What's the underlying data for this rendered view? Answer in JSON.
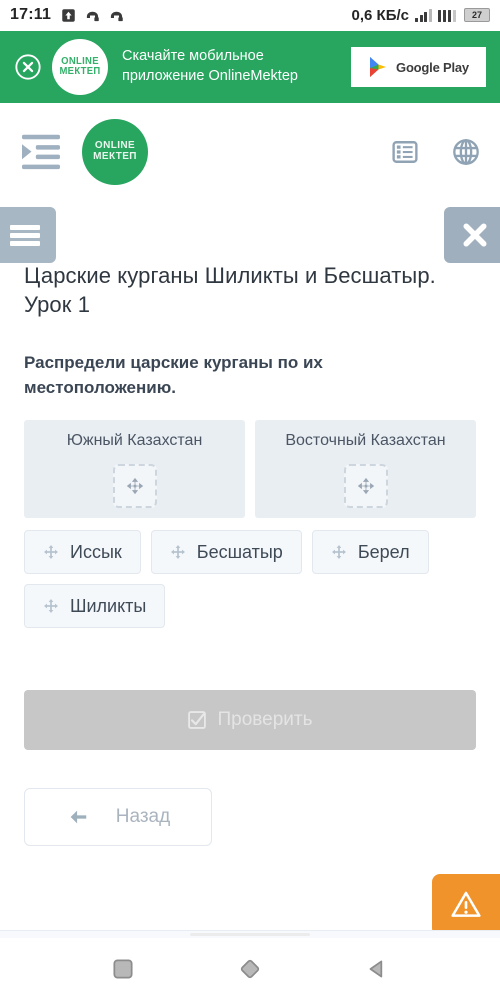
{
  "statusbar": {
    "time": "17:11",
    "network_speed": "0,6 КБ/с",
    "battery_percent": "27",
    "icons": [
      "upload-arrow-icon",
      "call-forward-icon",
      "call-forward-icon",
      "signal-bars-icon",
      "signal-bars-icon",
      "battery-icon"
    ]
  },
  "banner": {
    "close_icon": "circle-close-icon",
    "logo_line1": "ONLINE",
    "logo_line2": "МЕКТЕП",
    "text_line1": "Скачайте мобильное",
    "text_line2": "приложение OnlineMektep",
    "store_button_label": "Google Play",
    "store_icon": "google-play-icon",
    "background_color": "#28a55f"
  },
  "site_header": {
    "indent_icon": "indent-list-icon",
    "logo_line1": "ONLINE",
    "logo_line2": "МЕКТЕП",
    "actions": [
      {
        "icon": "list-view-icon",
        "name": "tasks-list-button"
      },
      {
        "icon": "globe-icon",
        "name": "language-button"
      }
    ]
  },
  "controls": {
    "menu_button_icon": "hamburger-icon",
    "close_button_icon": "close-x-icon"
  },
  "lesson": {
    "title": "Царские курганы Шиликты и Бесшатыр. Урок 1",
    "task": "Распредели царские курганы по их местоположению.",
    "dropzones": [
      {
        "title": "Южный Казахстан",
        "slot_icon": "move-arrows-icon"
      },
      {
        "title": "Восточный Казахстан",
        "slot_icon": "move-arrows-icon"
      }
    ],
    "chips": [
      {
        "label": "Иссык",
        "icon": "move-arrows-icon"
      },
      {
        "label": "Бесшатыр",
        "icon": "move-arrows-icon"
      },
      {
        "label": "Берел",
        "icon": "move-arrows-icon"
      },
      {
        "label": "Шиликты",
        "icon": "move-arrows-icon"
      }
    ],
    "check_button": {
      "label": "Проверить",
      "icon": "check-square-icon",
      "disabled": true
    },
    "back_button": {
      "label": "Назад",
      "icon": "arrow-left-icon"
    }
  },
  "warning_fab": {
    "icon": "warning-triangle-icon",
    "color": "#f0932b"
  },
  "navbar": {
    "items": [
      {
        "icon": "square-recents-icon"
      },
      {
        "icon": "diamond-home-icon"
      },
      {
        "icon": "triangle-back-icon"
      }
    ]
  }
}
